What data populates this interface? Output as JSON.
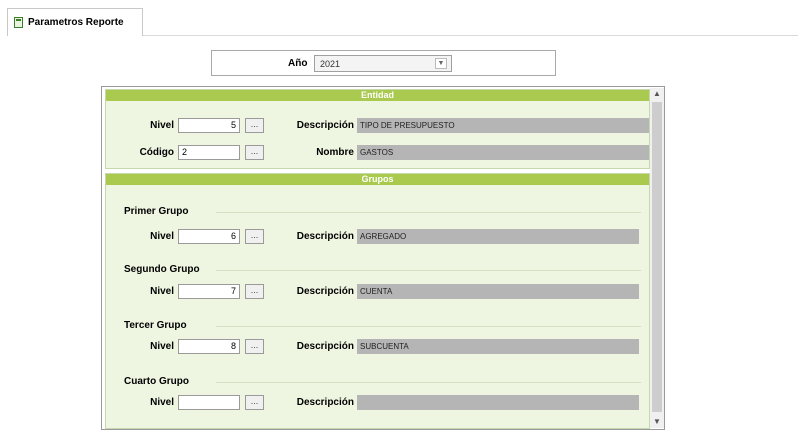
{
  "tab": {
    "label": "Parametros Reporte",
    "icon": "document-icon"
  },
  "year": {
    "label": "Año",
    "value": "2021",
    "dropdown_icon": "chevron-down-icon"
  },
  "entidad": {
    "title": "Entidad",
    "nivel_label": "Nivel",
    "nivel_value": "5",
    "codigo_label": "Código",
    "codigo_value": "2",
    "descripcion_label": "Descripción",
    "descripcion_value": "TIPO DE PRESUPUESTO",
    "nombre_label": "Nombre",
    "nombre_value": "GASTOS",
    "lookup_label": "..."
  },
  "grupos": {
    "title": "Grupos",
    "nivel_label": "Nivel",
    "descripcion_label": "Descripción",
    "lookup_label": "...",
    "items": [
      {
        "title": "Primer Grupo",
        "nivel": "6",
        "descripcion": "AGREGADO"
      },
      {
        "title": "Segundo Grupo",
        "nivel": "7",
        "descripcion": "CUENTA"
      },
      {
        "title": "Tercer Grupo",
        "nivel": "8",
        "descripcion": "SUBCUENTA"
      },
      {
        "title": "Cuarto Grupo",
        "nivel": "",
        "descripcion": ""
      }
    ]
  },
  "scrollbar": {
    "up_glyph": "▲",
    "down_glyph": "▼"
  }
}
